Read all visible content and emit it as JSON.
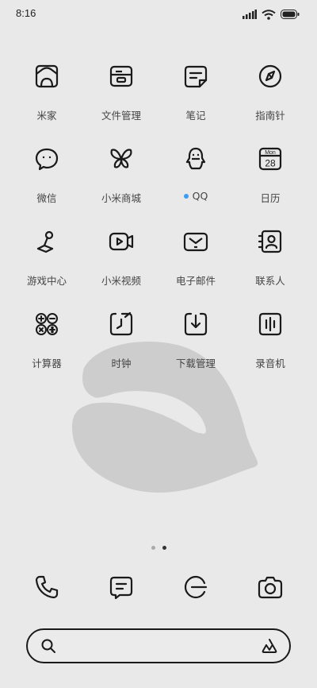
{
  "status": {
    "time": "8:16"
  },
  "apps": [
    {
      "label": "米家",
      "icon": "home-frame-icon"
    },
    {
      "label": "文件管理",
      "icon": "folder-icon"
    },
    {
      "label": "笔记",
      "icon": "notes-icon"
    },
    {
      "label": "指南针",
      "icon": "compass-icon"
    },
    {
      "label": "微信",
      "icon": "wechat-icon"
    },
    {
      "label": "小米商城",
      "icon": "butterfly-icon"
    },
    {
      "label": "QQ",
      "icon": "qq-penguin-icon"
    },
    {
      "label": "日历",
      "icon": "calendar-icon"
    },
    {
      "label": "游戏中心",
      "icon": "joystick-icon"
    },
    {
      "label": "小米视频",
      "icon": "video-icon"
    },
    {
      "label": "电子邮件",
      "icon": "mail-icon"
    },
    {
      "label": "联系人",
      "icon": "contacts-icon"
    },
    {
      "label": "计算器",
      "icon": "calculator-icon"
    },
    {
      "label": "时钟",
      "icon": "clock-icon"
    },
    {
      "label": "下载管理",
      "icon": "download-icon"
    },
    {
      "label": "录音机",
      "icon": "recorder-icon"
    }
  ],
  "calendar_icon": {
    "month": "Mon",
    "day": "28"
  },
  "page_indicator": {
    "count": 2,
    "active_index": 1
  },
  "dock": [
    {
      "icon": "phone-icon"
    },
    {
      "icon": "messages-icon"
    },
    {
      "icon": "browser-icon"
    },
    {
      "icon": "camera-icon"
    }
  ],
  "search": {
    "icon": "search-icon",
    "assistant_icon": "assistant-icon"
  },
  "colors": {
    "background": "#e9e9e9",
    "badge": "#3b9cf0",
    "wallpaper_shape": "#cdcdcd"
  }
}
